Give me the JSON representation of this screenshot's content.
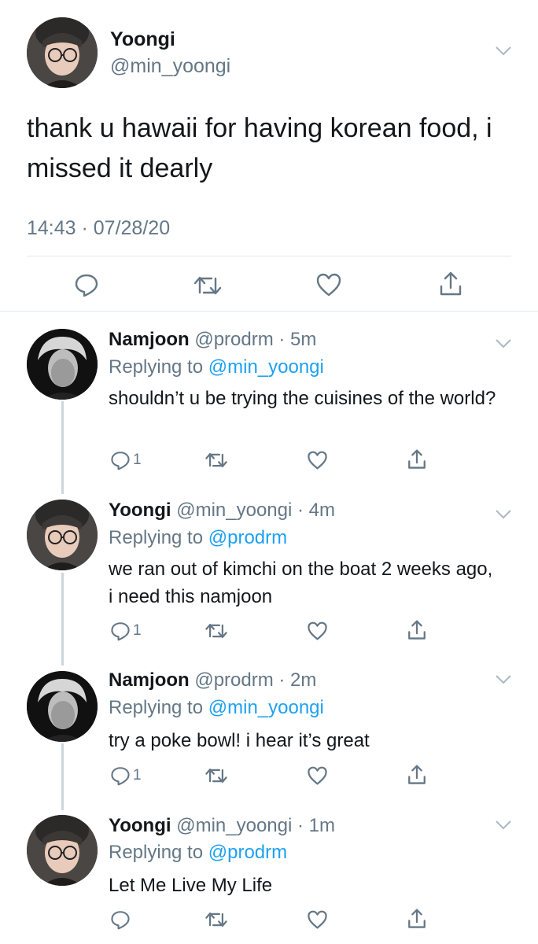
{
  "main_tweet": {
    "name": "Yoongi",
    "handle": "@min_yoongi",
    "text": "thank u hawaii for having korean food, i missed it dearly",
    "timestamp": "14:43 · 07/28/20",
    "actions": [
      "reply-icon",
      "retweet-icon",
      "like-icon",
      "share-icon"
    ]
  },
  "replies": [
    {
      "name": "Namjoon",
      "meta": "@prodrm · 5m",
      "replying_prefix": "Replying to ",
      "replying_to": "@min_yoongi",
      "text": "shouldn’t u be trying the cuisines of the world?",
      "reply_count": "1"
    },
    {
      "name": "Yoongi",
      "meta": "@min_yoongi · 4m",
      "replying_prefix": "Replying to ",
      "replying_to": "@prodrm",
      "text": "we ran out of kimchi on the boat 2 weeks ago, i need this namjoon",
      "reply_count": "1"
    },
    {
      "name": "Namjoon",
      "meta": "@prodrm · 2m",
      "replying_prefix": "Replying to ",
      "replying_to": "@min_yoongi",
      "text": "try a poke bowl! i hear it’s great",
      "reply_count": "1"
    },
    {
      "name": "Yoongi",
      "meta": "@min_yoongi · 1m",
      "replying_prefix": "Replying to ",
      "replying_to": "@prodrm",
      "text": "Let Me Live My Life",
      "reply_count": ""
    }
  ],
  "colors": {
    "text": "#14171a",
    "secondary": "#657786",
    "link": "#1da1f2",
    "divider": "#e1e8ed",
    "thread_line": "#ccd6dd"
  }
}
